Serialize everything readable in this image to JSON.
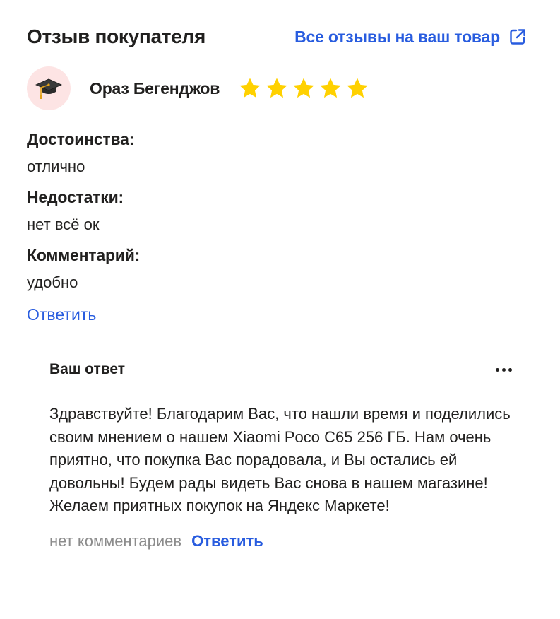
{
  "header": {
    "title": "Отзыв покупателя",
    "all_reviews_link": "Все отзывы на ваш товар",
    "link_icon": "external-link-icon"
  },
  "review": {
    "author": "Ораз Бегенджов",
    "avatar_icon": "graduation-cap-icon",
    "rating": 5,
    "rating_max": 5,
    "pros_label": "Достоинства:",
    "pros_value": "отлично",
    "cons_label": "Недостатки:",
    "cons_value": "нет всё ок",
    "comment_label": "Комментарий:",
    "comment_value": "удобно",
    "reply_label": "Ответить"
  },
  "answer": {
    "title": "Ваш ответ",
    "more_icon": "more-horizontal-icon",
    "text": "Здравствуйте! Благодарим Вас, что нашли время и поделились своим мнением о нашем Xiaomi Poco C65 256 ГБ. Нам очень приятно, что покупка Вас порадовала, и Вы остались ей довольны! Будем рады видеть Вас снова в нашем магазине! Желаем приятных покупок на Яндекс Маркете!",
    "no_comments": "нет комментариев",
    "reply_label": "Ответить"
  },
  "colors": {
    "link": "#285cdf",
    "text": "#21201f",
    "muted": "#8c8c8c",
    "star": "#ffd100",
    "avatar_bg": "#fde4e4"
  }
}
